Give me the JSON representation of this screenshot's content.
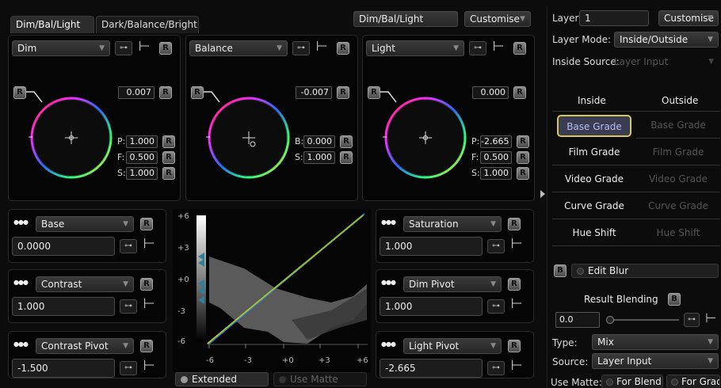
{
  "header": {
    "tabs": [
      "Dim/Bal/Light",
      "Dark/Balance/Bright"
    ],
    "preset": "Dim/Bal/Light",
    "customise": "Customise"
  },
  "wheels": [
    {
      "mode": "Dim",
      "offset": "0.007",
      "p_label": "P:",
      "p": "1.000",
      "f_label": "F:",
      "f": "0.500",
      "s_label": "S:",
      "s": "1.000"
    },
    {
      "mode": "Balance",
      "offset": "-0.007",
      "b_label": "B:",
      "b": "0.000",
      "s_label": "S:",
      "s": "1.000"
    },
    {
      "mode": "Light",
      "offset": "0.000",
      "p_label": "P:",
      "p": "-2.665",
      "f_label": "F:",
      "f": "0.500",
      "s_label": "S:",
      "s": "1.000"
    }
  ],
  "left_params": [
    {
      "name": "Base",
      "value": "0.0000"
    },
    {
      "name": "Contrast",
      "value": "1.000"
    },
    {
      "name": "Contrast Pivot",
      "value": "-1.500"
    }
  ],
  "right_params": [
    {
      "name": "Saturation",
      "value": "1.000"
    },
    {
      "name": "Dim Pivot",
      "value": "1.000"
    },
    {
      "name": "Light Pivot",
      "value": "-2.665"
    }
  ],
  "graph": {
    "y_ticks": [
      "+6",
      "+3",
      "+0",
      "-3",
      "-6"
    ],
    "x_ticks": [
      "-6",
      "-3",
      "+0",
      "+3",
      "+6"
    ],
    "extended": "Extended",
    "use_matte": "Use Matte"
  },
  "glyphs": {
    "key": "⊶",
    "curve": "⊢",
    "reset": "R",
    "dots": "●●●",
    "caret": "▼",
    "blur": "B"
  },
  "sidebar": {
    "layer_label": "Layer:",
    "layer_value": "1",
    "customise": "Customise",
    "layer_mode_label": "Layer Mode:",
    "layer_mode_value": "Inside/Outside",
    "inside_source_label": "Inside Source:",
    "inside_source_value": "Layer Input",
    "inside_header": "Inside",
    "outside_header": "Outside",
    "grades": [
      "Base Grade",
      "Film Grade",
      "Video Grade",
      "Curve Grade",
      "Hue Shift"
    ],
    "edit_blur": "Edit Blur",
    "result_blending": "Result Blending",
    "blend_value": "0.0",
    "type_label": "Type:",
    "type_value": "Mix",
    "source_label": "Source:",
    "source_value": "Layer Input",
    "use_matte_label": "Use Matte:",
    "for_blend": "For Blend",
    "for_grade": "For Grade"
  }
}
